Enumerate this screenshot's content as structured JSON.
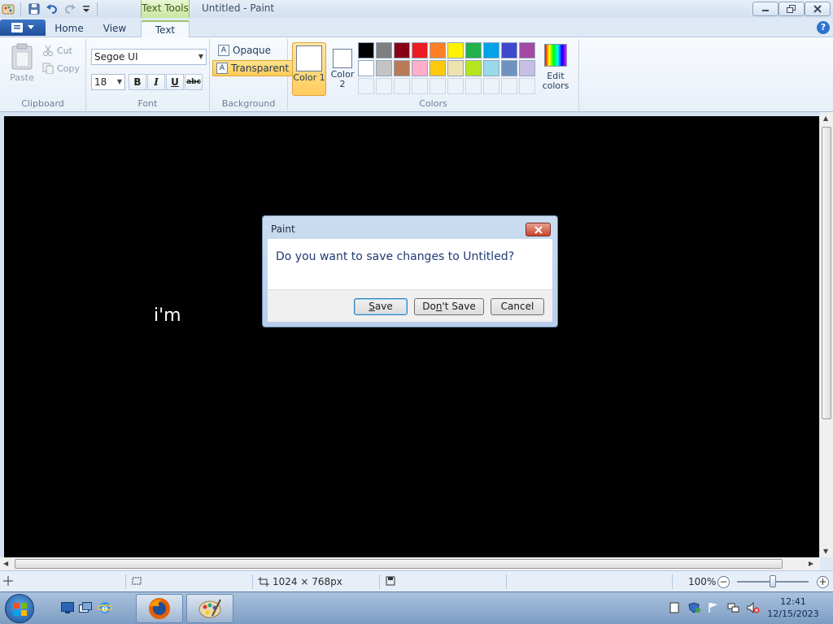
{
  "titlebar": {
    "context_tab": "Text Tools",
    "window_title": "Untitled - Paint"
  },
  "tabs": [
    {
      "label": "Home"
    },
    {
      "label": "View"
    },
    {
      "label": "Text"
    }
  ],
  "ribbon": {
    "clipboard": {
      "paste": "Paste",
      "cut": "Cut",
      "copy": "Copy",
      "group_label": "Clipboard"
    },
    "font": {
      "family": "Segoe UI",
      "size": "18",
      "bold": "B",
      "italic": "I",
      "underline": "U",
      "strike": "abc",
      "group_label": "Font"
    },
    "background": {
      "opaque": "Opaque",
      "transparent": "Transparent",
      "group_label": "Background"
    },
    "colors": {
      "color1": "Color 1",
      "color2": "Color 2",
      "edit_colors": "Edit colors",
      "group_label": "Colors",
      "palette_row1": [
        "#000000",
        "#7f7f7f",
        "#880015",
        "#ed1c24",
        "#ff7f27",
        "#fff200",
        "#22b14c",
        "#00a2e8",
        "#3f48cc",
        "#a349a4"
      ],
      "palette_row2": [
        "#ffffff",
        "#c3c3c3",
        "#b97a57",
        "#ffaec9",
        "#ffc90e",
        "#efe4b0",
        "#b5e61d",
        "#99d9ea",
        "#7092be",
        "#c8bfe7"
      ]
    }
  },
  "canvas": {
    "text": "i'm"
  },
  "dialog": {
    "title": "Paint",
    "message": "Do you want to save changes to Untitled?",
    "save_pre": "",
    "save_u": "S",
    "save_post": "ave",
    "dontsave_pre": "Do",
    "dontsave_u": "n",
    "dontsave_post": "'t Save",
    "cancel": "Cancel"
  },
  "statusbar": {
    "dimensions": "1024 × 768px",
    "zoom": "100%"
  },
  "taskbar": {
    "time": "12:41",
    "date": "12/15/2023"
  }
}
